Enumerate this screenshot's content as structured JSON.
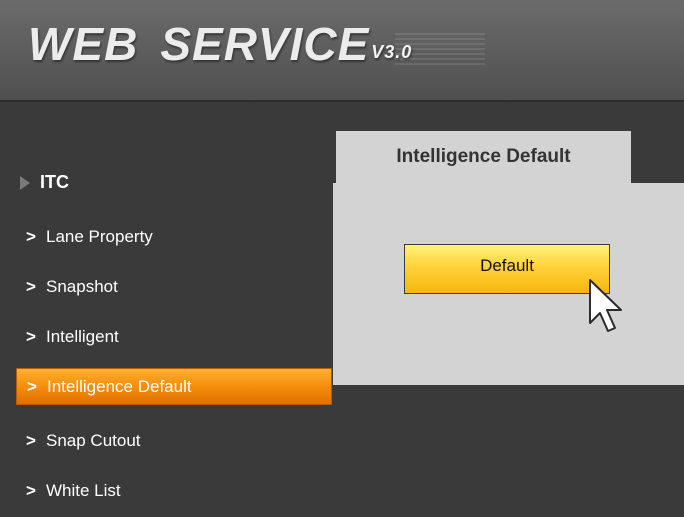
{
  "header": {
    "title_part1": "WEB",
    "title_part2": "SERVICE",
    "version": "V3.0"
  },
  "sidebar": {
    "section_label": "ITC",
    "items": [
      {
        "label": "Lane Property",
        "active": false
      },
      {
        "label": "Snapshot",
        "active": false
      },
      {
        "label": "Intelligent",
        "active": false
      },
      {
        "label": "Intelligence Default",
        "active": true
      },
      {
        "label": "Snap Cutout",
        "active": false
      },
      {
        "label": "White List",
        "active": false
      }
    ],
    "chevron": ">"
  },
  "content": {
    "tab_label": "Intelligence Default",
    "default_button_label": "Default"
  },
  "colors": {
    "background": "#3a3a3a",
    "active_item": "#f58a0a",
    "panel": "#d3d3d3",
    "button": "#ffd23a"
  }
}
